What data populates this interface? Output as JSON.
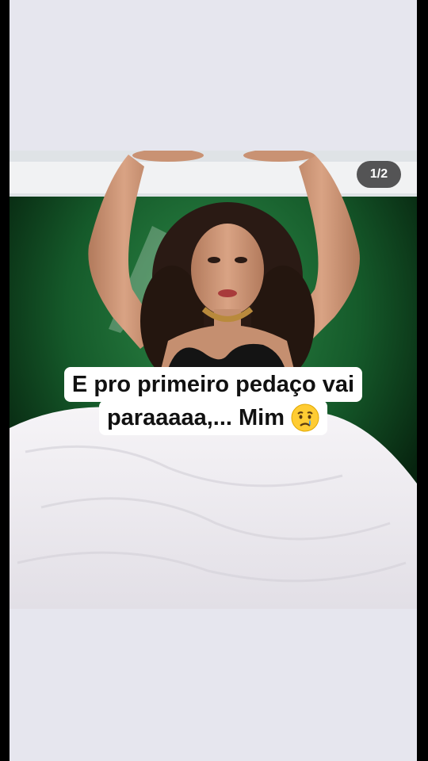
{
  "story": {
    "page_counter": "1/2",
    "caption_lines": [
      "E pro primeiro pedaço vai",
      "paraaaaa,... Mim"
    ],
    "caption_emoji": "crying-face-icon"
  },
  "colors": {
    "background": "#e6e6ee",
    "counter_bg": "#2a2a2a",
    "caption_bg": "#ffffff",
    "caption_text": "#111111",
    "backdrop_green": "#1d6b35"
  }
}
